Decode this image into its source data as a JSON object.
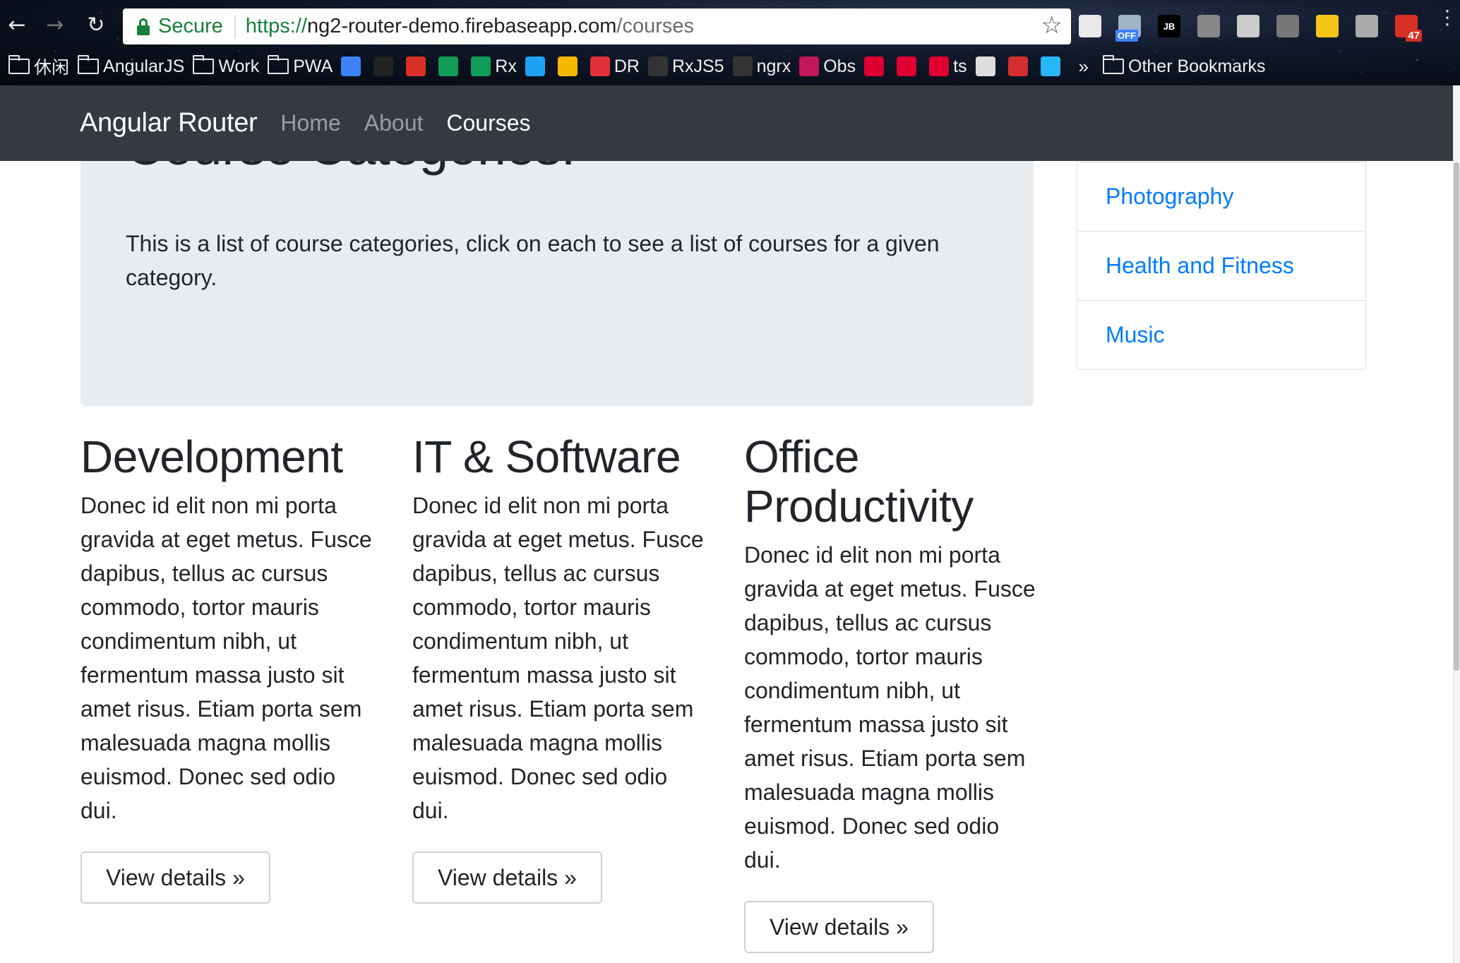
{
  "browser": {
    "secure_label": "Secure",
    "url_scheme": "https://",
    "url_host": "ng2-router-demo.firebaseapp.com",
    "url_path": "/courses",
    "extensions": [
      {
        "name": "notes-extension-icon",
        "label": "",
        "color": "#e8e8e8"
      },
      {
        "name": "off-extension-icon",
        "label": "OFF",
        "color": "#9fb3c8"
      },
      {
        "name": "jetbrains-extension-icon",
        "label": "JB",
        "color": "#000000"
      },
      {
        "name": "angular-extension-icon",
        "label": "",
        "color": "#888888"
      },
      {
        "name": "target-extension-icon",
        "label": "",
        "color": "#cccccc"
      },
      {
        "name": "inbox-extension-icon",
        "label": "",
        "color": "#777777"
      },
      {
        "name": "moon-extension-icon",
        "label": "",
        "color": "#f5c518"
      },
      {
        "name": "grid-extension-icon",
        "label": "",
        "color": "#aaaaaa"
      },
      {
        "name": "gmail-extension-icon",
        "label": "47",
        "color": "#d93025"
      }
    ],
    "bookmarks": [
      {
        "name": "bookmark-xiuxian",
        "label": "休闲",
        "type": "folder"
      },
      {
        "name": "bookmark-angularjs",
        "label": "AngularJS",
        "type": "folder"
      },
      {
        "name": "bookmark-work",
        "label": "Work",
        "type": "folder"
      },
      {
        "name": "bookmark-pwa",
        "label": "PWA",
        "type": "folder"
      },
      {
        "name": "bookmark-ionic",
        "label": "",
        "type": "icon",
        "color": "#3b82f6"
      },
      {
        "name": "bookmark-dark-1",
        "label": "",
        "type": "icon",
        "color": "#222222"
      },
      {
        "name": "bookmark-gmail",
        "label": "",
        "type": "icon",
        "color": "#d93025"
      },
      {
        "name": "bookmark-sheets",
        "label": "",
        "type": "icon",
        "color": "#0f9d58"
      },
      {
        "name": "bookmark-rx",
        "label": "Rx",
        "type": "icon",
        "color": "#0f9d58"
      },
      {
        "name": "bookmark-twitter",
        "label": "",
        "type": "icon",
        "color": "#1da1f2"
      },
      {
        "name": "bookmark-box",
        "label": "",
        "type": "icon",
        "color": "#f5b800"
      },
      {
        "name": "bookmark-dr",
        "label": "DR",
        "type": "icon",
        "color": "#e0303a"
      },
      {
        "name": "bookmark-rxjs5",
        "label": "RxJS5",
        "type": "icon",
        "color": "#333333"
      },
      {
        "name": "bookmark-ngrx",
        "label": "ngrx",
        "type": "icon",
        "color": "#333333"
      },
      {
        "name": "bookmark-obs",
        "label": "Obs",
        "type": "icon",
        "color": "#c2185b"
      },
      {
        "name": "bookmark-angular-1",
        "label": "",
        "type": "icon",
        "color": "#dd0031"
      },
      {
        "name": "bookmark-angular-2",
        "label": "",
        "type": "icon",
        "color": "#dd0031"
      },
      {
        "name": "bookmark-ts",
        "label": "ts",
        "type": "icon",
        "color": "#dd0031"
      },
      {
        "name": "bookmark-face",
        "label": "",
        "type": "icon",
        "color": "#dddddd"
      },
      {
        "name": "bookmark-flash",
        "label": "",
        "type": "icon",
        "color": "#d32f2f"
      },
      {
        "name": "bookmark-u",
        "label": "",
        "type": "icon",
        "color": "#29b6f6"
      }
    ],
    "overflow_label": "»",
    "other_bookmarks_label": "Other Bookmarks"
  },
  "navbar": {
    "brand": "Angular Router",
    "links": [
      {
        "label": "Home",
        "active": false
      },
      {
        "label": "About",
        "active": false
      },
      {
        "label": "Courses",
        "active": true
      }
    ]
  },
  "jumbotron": {
    "title": "Course Categories!",
    "lead": "This is a list of course categories, click on each to see a list of courses for a given category."
  },
  "category_list": [
    "",
    "Photography",
    "Health and Fitness",
    "Music"
  ],
  "courses": [
    {
      "title": "Development",
      "description": "Donec id elit non mi porta gravida at eget metus. Fusce dapibus, tellus ac cursus commodo, tortor mauris condimentum nibh, ut fermentum massa justo sit amet risus. Etiam porta sem malesuada magna mollis euismod. Donec sed odio dui.",
      "button": "View details »"
    },
    {
      "title": "IT & Software",
      "description": "Donec id elit non mi porta gravida at eget metus. Fusce dapibus, tellus ac cursus commodo, tortor mauris condimentum nibh, ut fermentum massa justo sit amet risus. Etiam porta sem malesuada magna mollis euismod. Donec sed odio dui.",
      "button": "View details »"
    },
    {
      "title": "Office Productivity",
      "description": "Donec id elit non mi porta gravida at eget metus. Fusce dapibus, tellus ac cursus commodo, tortor mauris condimentum nibh, ut fermentum massa justo sit amet risus. Etiam porta sem malesuada magna mollis euismod. Donec sed odio dui.",
      "button": "View details »"
    }
  ]
}
